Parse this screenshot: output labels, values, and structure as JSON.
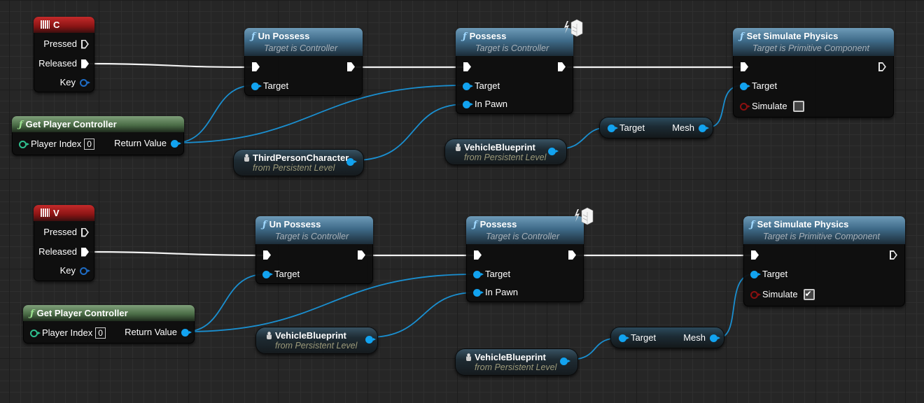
{
  "graph": {
    "group_c": {
      "key_event": {
        "title": "C",
        "icon": "keyboard-icon",
        "pins": {
          "pressed": "Pressed",
          "released": "Released",
          "key": "Key"
        }
      },
      "get_player_controller": {
        "title": "Get Player Controller",
        "icon": "function-icon",
        "player_index_label": "Player Index",
        "player_index_value": "0",
        "return_label": "Return Value"
      },
      "un_possess": {
        "title": "Un Possess",
        "subtitle": "Target is Controller",
        "icon": "function-icon",
        "target_label": "Target"
      },
      "third_person_character": {
        "title": "ThirdPersonCharacter",
        "subtitle": "from Persistent Level",
        "icon": "actor-icon"
      },
      "possess": {
        "title": "Possess",
        "subtitle": "Target is Controller",
        "icon": "function-icon",
        "badge_icon": "authority-only-icon",
        "target_label": "Target",
        "in_pawn_label": "In Pawn"
      },
      "vehicle_blueprint": {
        "title": "VehicleBlueprint",
        "subtitle": "from Persistent Level",
        "icon": "actor-icon"
      },
      "get_mesh": {
        "target_label": "Target",
        "output_label": "Mesh"
      },
      "set_simulate_physics": {
        "title": "Set Simulate Physics",
        "subtitle": "Target is Primitive Component",
        "icon": "function-icon",
        "target_label": "Target",
        "simulate_label": "Simulate",
        "simulate_value": false
      }
    },
    "group_v": {
      "key_event": {
        "title": "V",
        "icon": "keyboard-icon",
        "pins": {
          "pressed": "Pressed",
          "released": "Released",
          "key": "Key"
        }
      },
      "get_player_controller": {
        "title": "Get Player Controller",
        "icon": "function-icon",
        "player_index_label": "Player Index",
        "player_index_value": "0",
        "return_label": "Return Value"
      },
      "un_possess": {
        "title": "Un Possess",
        "subtitle": "Target is Controller",
        "icon": "function-icon",
        "target_label": "Target"
      },
      "vehicle_blueprint_pawn": {
        "title": "VehicleBlueprint",
        "subtitle": "from Persistent Level",
        "icon": "actor-icon"
      },
      "possess": {
        "title": "Possess",
        "subtitle": "Target is Controller",
        "icon": "function-icon",
        "badge_icon": "authority-only-icon",
        "target_label": "Target",
        "in_pawn_label": "In Pawn"
      },
      "vehicle_blueprint": {
        "title": "VehicleBlueprint",
        "subtitle": "from Persistent Level",
        "icon": "actor-icon"
      },
      "get_mesh": {
        "target_label": "Target",
        "output_label": "Mesh"
      },
      "set_simulate_physics": {
        "title": "Set Simulate Physics",
        "subtitle": "Target is Primitive Component",
        "icon": "function-icon",
        "target_label": "Target",
        "simulate_label": "Simulate",
        "simulate_value": true
      }
    }
  },
  "colors": {
    "exec_wire": "#ffffff",
    "object_wire": "#1a8fd0",
    "event_header": "#a01c1c",
    "function_header": "#4a7795",
    "pure_header": "#5d8258",
    "canvas": "#262626"
  }
}
